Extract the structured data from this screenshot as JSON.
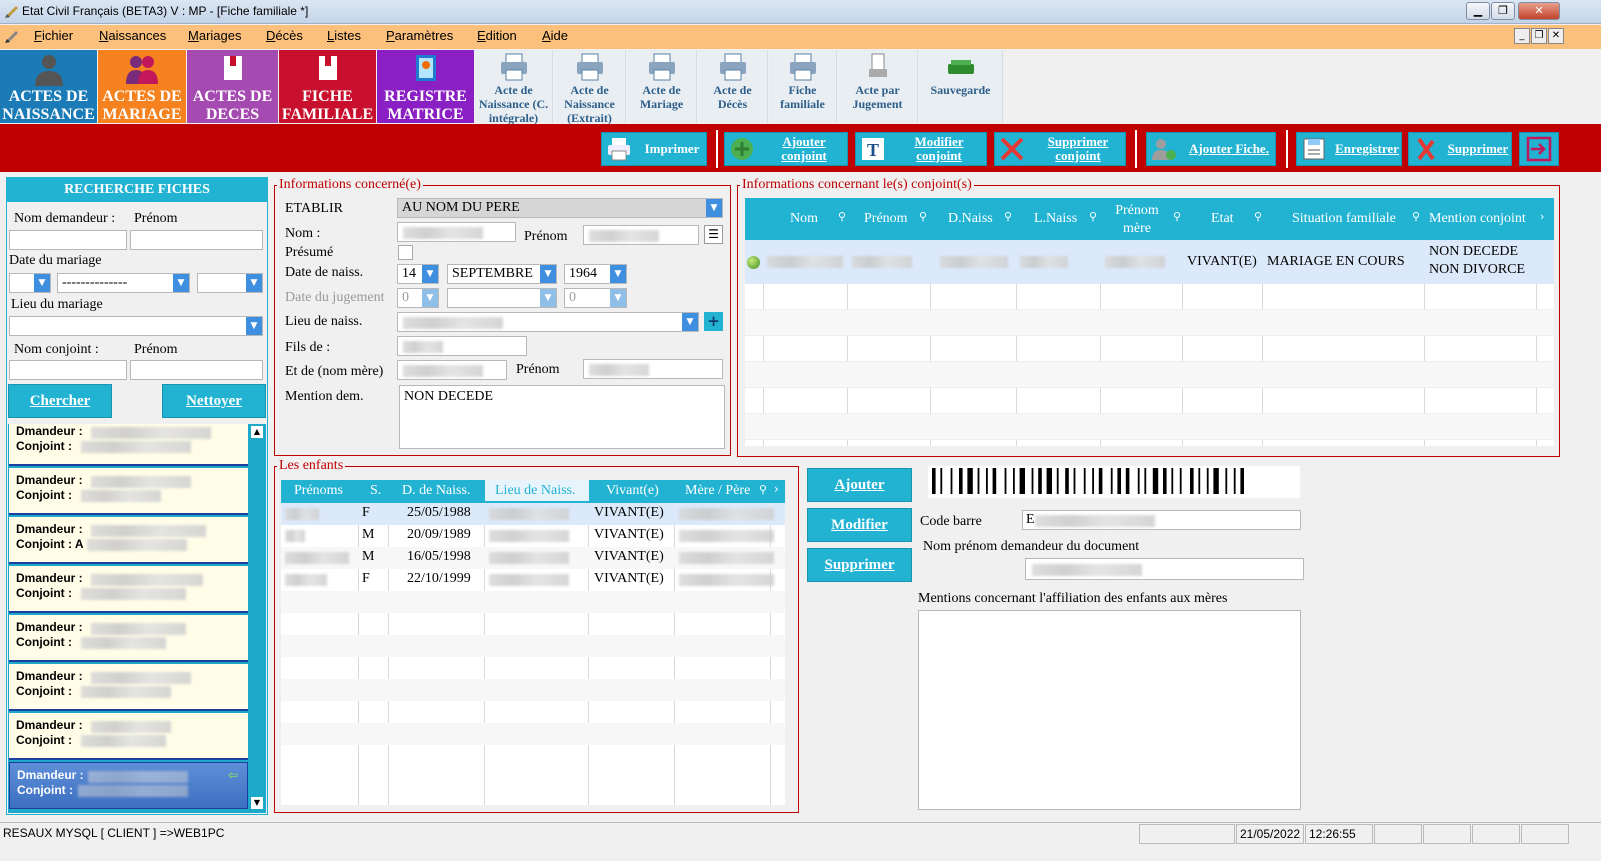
{
  "window": {
    "title": "Etat Civil Français (BETA3)  V : MP  - [Fiche familiale *]"
  },
  "menu": {
    "items": [
      "Fichier",
      "Naissances",
      "Mariages",
      "Décès",
      "Listes",
      "Paramètres",
      "Edition",
      "Aide"
    ]
  },
  "tiles": [
    {
      "label": "ACTES DE NAISSANCE",
      "color": "#1a7bb6",
      "icon": "person-icon"
    },
    {
      "label": "ACTES DE MARIAGE",
      "color": "#f5821f",
      "icon": "couple-icon"
    },
    {
      "label": "ACTES DE DECES",
      "color": "#a44ab0",
      "icon": "book-icon"
    },
    {
      "label": "FICHE FAMILIALE",
      "color": "#c8102e",
      "icon": "book-icon"
    },
    {
      "label": "REGISTRE MATRICE",
      "color": "#8a1fc4",
      "icon": "register-icon"
    }
  ],
  "print_tiles": [
    "Acte de Naissance (C. intégrale)",
    "Acte de Naissance (Extrait)",
    "Acte de Mariage",
    "Acte de Décès",
    "Fiche familiale",
    "Acte par Jugement",
    "Sauvegarde"
  ],
  "toolbar": {
    "imprimer": "Imprimer",
    "ajouter_conjoint": "Ajouter conjoint",
    "modifier_conjoint": "Modifier conjoint",
    "supprimer_conjoint": "Supprimer conjoint",
    "ajouter_fiche": "Ajouter Fiche.",
    "enregistrer": "Enregistrer",
    "supprimer": "Supprimer"
  },
  "search": {
    "header": "RECHERCHE FICHES",
    "nom_demandeur": "Nom demandeur :",
    "prenom1": "Prénom",
    "date_mariage": "Date du mariage",
    "date_sep": "--------------",
    "lieu_mariage": "Lieu du mariage",
    "nom_conjoint": "Nom conjoint :",
    "prenom2": "Prénom",
    "chercher": "Chercher",
    "nettoyer": "Nettoyer"
  },
  "results": [
    {
      "a": "Dmandeur :",
      "b": "Conjoint :"
    },
    {
      "a": "Dmandeur :",
      "b": "Conjoint :"
    },
    {
      "a": "Dmandeur :",
      "b": "Conjoint : A"
    },
    {
      "a": "Dmandeur :",
      "b": "Conjoint :"
    },
    {
      "a": "Dmandeur :",
      "b": "Conjoint :"
    },
    {
      "a": "Dmandeur :",
      "b": "Conjoint :"
    },
    {
      "a": "Dmandeur :",
      "b": "Conjoint :"
    },
    {
      "a": "Dmandeur :",
      "b": "Conjoint :"
    }
  ],
  "info": {
    "legend": "Informations concerné(e)",
    "etablir": "ETABLIR",
    "etablir_val": "AU NOM DU PERE",
    "nom": "Nom :",
    "prenom": "Prénom",
    "presume": "Présumé",
    "date_naiss": "Date de naiss.",
    "day": "14",
    "month": "SEPTEMBRE",
    "year": "1964",
    "date_jugement": "Date du jugement",
    "j_day": "0",
    "j_year": "0",
    "lieu_naiss": "Lieu de naiss.",
    "fils_de": "Fils de :",
    "et_de": "Et de (nom mère)",
    "prenom_mere": "Prénom",
    "mention_dem": "Mention dem.",
    "mention_val": "NON DECEDE"
  },
  "conjoints": {
    "legend": "Informations concernant le(s) conjoint(s)",
    "headers": [
      "Nom",
      "Prénom",
      "D.Naiss",
      "L.Naiss",
      "Prénom mère",
      "Etat",
      "Situation familiale",
      "Mention conjoint"
    ],
    "row": {
      "etat": "VIVANT(E)",
      "situation": "MARIAGE EN COURS",
      "mention1": "NON DECEDE",
      "mention2": "NON DIVORCE"
    }
  },
  "enfants": {
    "legend": "Les enfants",
    "headers": [
      "Prénoms",
      "S.",
      "D. de Naiss.",
      "Lieu de Naiss.",
      "Vivant(e)",
      "Mère / Père"
    ],
    "rows": [
      {
        "s": "F",
        "d": "25/05/1988",
        "v": "VIVANT(E)"
      },
      {
        "s": "M",
        "d": "20/09/1989",
        "v": "VIVANT(E)"
      },
      {
        "s": "M",
        "d": "16/05/1998",
        "v": "VIVANT(E)"
      },
      {
        "s": "F",
        "d": "22/10/1999",
        "v": "VIVANT(E)"
      }
    ]
  },
  "side": {
    "ajouter": "Ajouter",
    "modifier": "Modifier",
    "supprimer": "Supprimer",
    "code_barre": "Code barre",
    "code_val": "E",
    "nom_prenom": "Nom prénom demandeur du document",
    "mentions": "Mentions concernant l'affiliation des enfants aux mères"
  },
  "status": {
    "conn": "RESAUX MYSQL [ CLIENT ] =>WEB1PC",
    "date": "21/05/2022",
    "time": "12:26:55"
  }
}
